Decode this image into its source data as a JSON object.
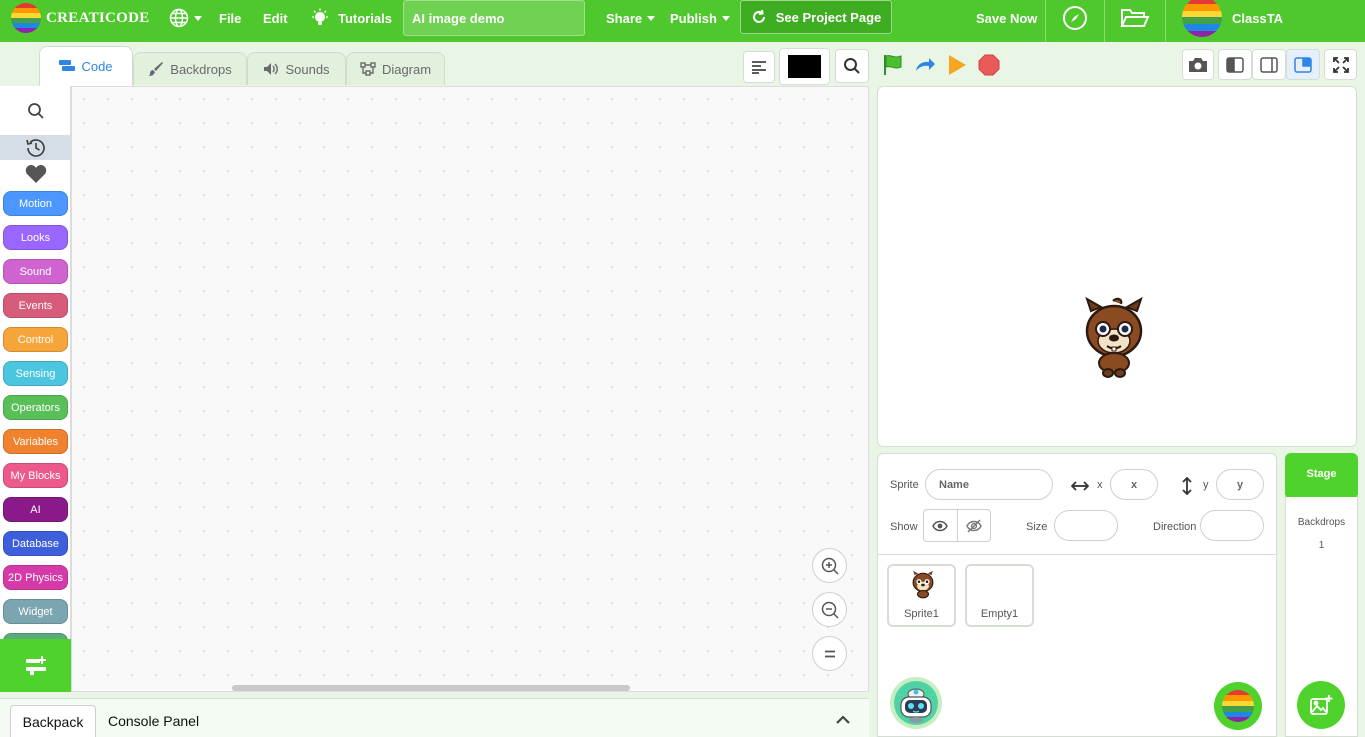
{
  "menubar": {
    "brand": "CREATICODE",
    "file": "File",
    "edit": "Edit",
    "tutorials": "Tutorials",
    "project_title": "AI image demo",
    "share": "Share",
    "publish": "Publish",
    "see_project_page": "See Project Page",
    "save_now": "Save Now",
    "username": "ClassTA"
  },
  "tabs": [
    {
      "label": "Code"
    },
    {
      "label": "Backdrops"
    },
    {
      "label": "Sounds"
    },
    {
      "label": "Diagram"
    }
  ],
  "categories": [
    {
      "label": "Motion",
      "color": "#4c97ff"
    },
    {
      "label": "Looks",
      "color": "#9966ff"
    },
    {
      "label": "Sound",
      "color": "#cf63cf"
    },
    {
      "label": "Events",
      "color": "#d65c7a"
    },
    {
      "label": "Control",
      "color": "#f5a53a"
    },
    {
      "label": "Sensing",
      "color": "#4cc6e0"
    },
    {
      "label": "Operators",
      "color": "#59c059"
    },
    {
      "label": "Variables",
      "color": "#f0822e"
    },
    {
      "label": "My Blocks",
      "color": "#ec5a8c"
    },
    {
      "label": "AI",
      "color": "#8a1a8a"
    },
    {
      "label": "Database",
      "color": "#3e5fdb"
    },
    {
      "label": "2D Physics",
      "color": "#d63aa8"
    },
    {
      "label": "Widget",
      "color": "#7ba5b0"
    }
  ],
  "bottom": {
    "backpack": "Backpack",
    "console": "Console Panel"
  },
  "sprite_info": {
    "sprite_label": "Sprite",
    "name_placeholder": "Name",
    "x_label": "x",
    "x_placeholder": "x",
    "y_label": "y",
    "y_placeholder": "y",
    "show_label": "Show",
    "size_label": "Size",
    "direction_label": "Direction"
  },
  "sprites": [
    {
      "name": "Sprite1"
    },
    {
      "name": "Empty1"
    }
  ],
  "stage_pane": {
    "title": "Stage",
    "backdrops_label": "Backdrops",
    "backdrops_count": "1"
  },
  "colors": {
    "brand_green": "#4fc82d",
    "accent_blue": "#2f86e6"
  }
}
